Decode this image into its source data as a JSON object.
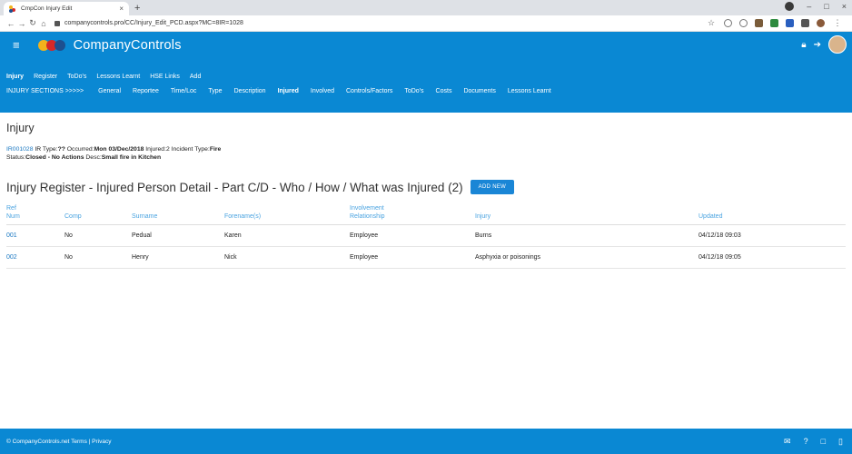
{
  "browser": {
    "tab_title": "CmpCon Injury Edit",
    "tab_close": "×",
    "new_tab": "+",
    "url": "companycontrols.pro/CC/Injury_Edit_PCD.aspx?MC=8IR=1028",
    "window_controls": [
      "–",
      "□",
      "×"
    ]
  },
  "app": {
    "brand": "CompanyControls",
    "logo_colors": [
      "#f2b21c",
      "#d62828",
      "#1d4f8f"
    ]
  },
  "menu1": [
    "Injury",
    "Register",
    "ToDo's",
    "Lessons Learnt",
    "HSE Links",
    "Add"
  ],
  "menu2": {
    "label": "INJURY SECTIONS >>>>>",
    "items": [
      "General",
      "Reportee",
      "Time/Loc",
      "Type",
      "Description",
      "Injured",
      "Involved",
      "Controls/Factors",
      "ToDo's",
      "Costs",
      "Documents",
      "Lessons Learnt"
    ]
  },
  "page": {
    "title": "Injury"
  },
  "summary": {
    "ref": "IR001028",
    "ir_type_label": "IR Type:",
    "ir_type": "??",
    "occurred_label": "Occurred:",
    "occurred": "Mon 03/Dec/2018",
    "injured_label": "Injured:",
    "injured": "2",
    "incident_type_label": "Incident Type:",
    "incident_type": "Fire",
    "status_label": "Status:",
    "status": "Closed - No Actions",
    "desc_label": "Desc:",
    "desc": "Small fire in Kitchen"
  },
  "section": {
    "title": "Injury Register - Injured Person Detail - Part C/D - Who / How / What was Injured (2)",
    "add_button": "ADD NEW"
  },
  "table": {
    "headers": [
      {
        "line1": "Ref",
        "line2": "Num"
      },
      {
        "line1": "",
        "line2": "Comp"
      },
      {
        "line1": "",
        "line2": "Surname"
      },
      {
        "line1": "",
        "line2": "Forename(s)"
      },
      {
        "line1": "Involvement",
        "line2": "Relationship"
      },
      {
        "line1": "",
        "line2": "Injury"
      },
      {
        "line1": "",
        "line2": "Updated"
      }
    ],
    "rows": [
      [
        "001",
        "No",
        "Pedual",
        "Karen",
        "Employee",
        "Burns",
        "04/12/18 09:03"
      ],
      [
        "002",
        "No",
        "Henry",
        "Nick",
        "Employee",
        "Asphyxia or poisonings",
        "04/12/18 09:05"
      ]
    ]
  },
  "footer": {
    "text": "© CompanyControls.net Terms | Privacy"
  }
}
